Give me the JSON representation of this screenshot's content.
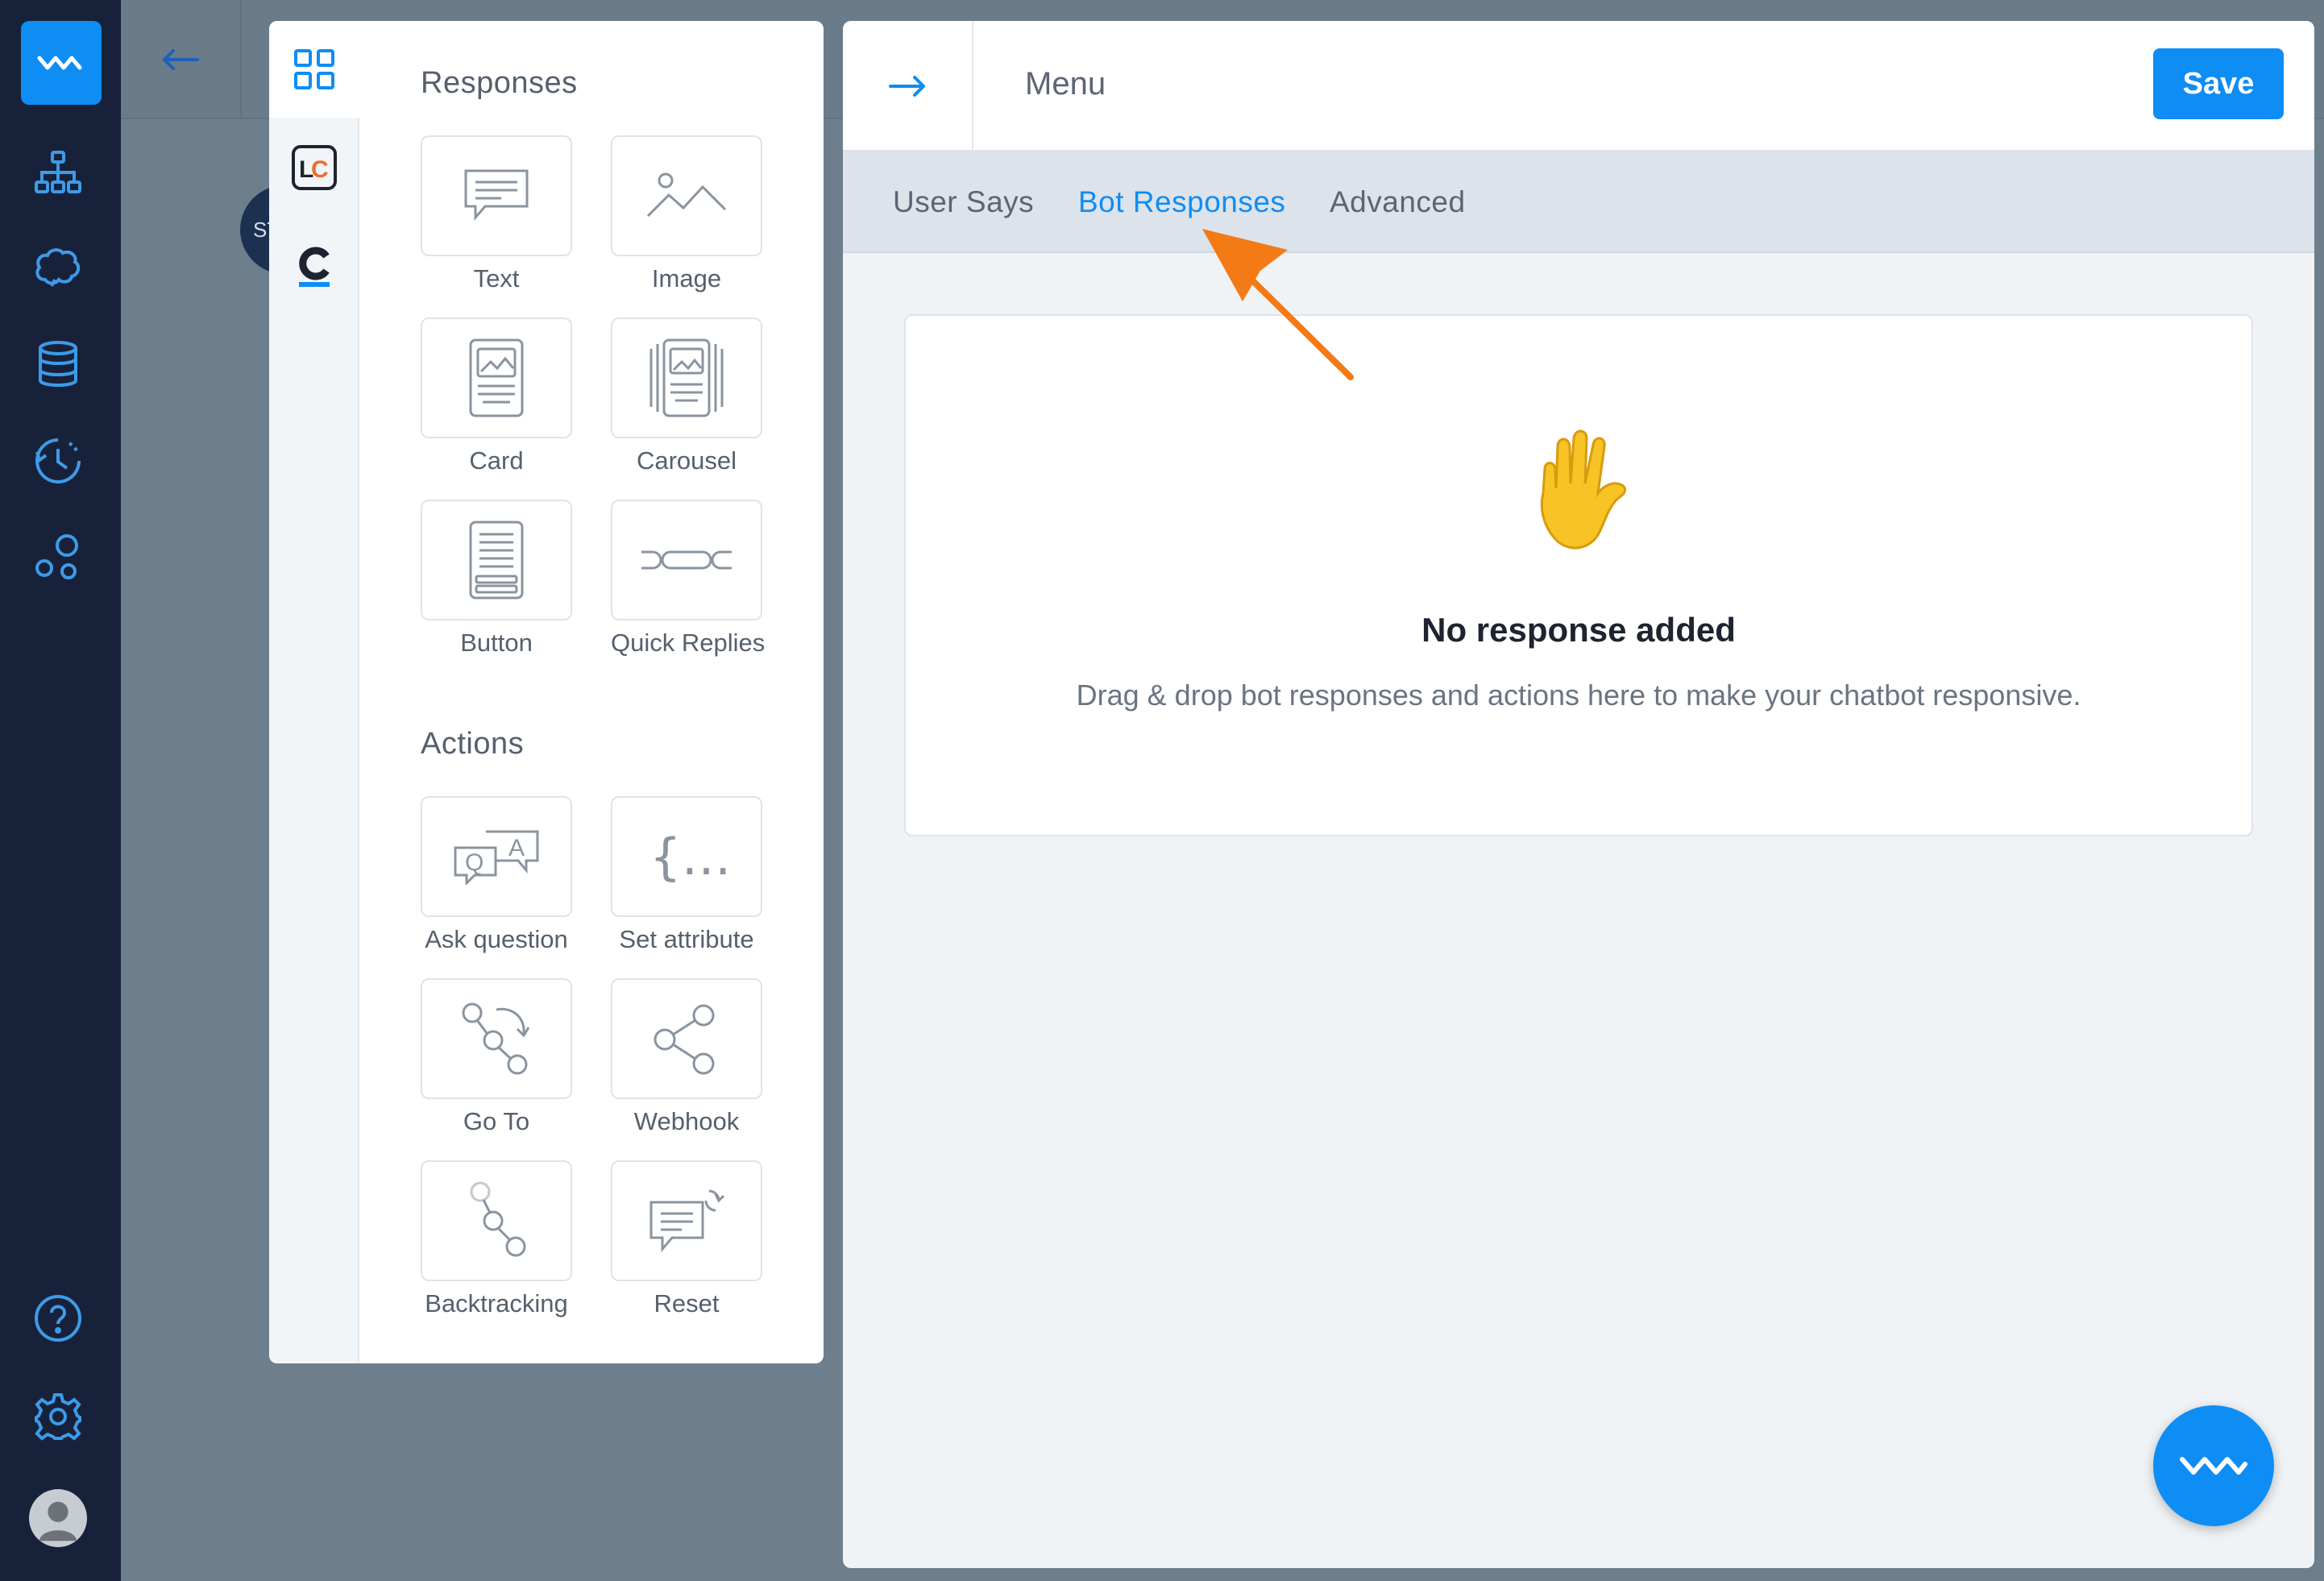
{
  "rail": {
    "brand_color": "#0e8df5",
    "icons": [
      "logo-wave-icon",
      "flow-tree-icon",
      "brain-icon",
      "database-icon",
      "history-clock-icon",
      "integrations-icon",
      "help-icon",
      "settings-gear-icon",
      "user-avatar"
    ]
  },
  "canvas": {
    "start_node_label": "ST"
  },
  "palette": {
    "tabs": [
      "grid-icon",
      "livechat-icon",
      "chatbot-c-icon"
    ],
    "responses_title": "Responses",
    "responses": [
      {
        "label": "Text",
        "icon": "text-bubble-icon"
      },
      {
        "label": "Image",
        "icon": "image-icon"
      },
      {
        "label": "Card",
        "icon": "card-icon"
      },
      {
        "label": "Carousel",
        "icon": "carousel-icon"
      },
      {
        "label": "Button",
        "icon": "button-icon"
      },
      {
        "label": "Quick Replies",
        "icon": "quick-replies-icon"
      }
    ],
    "actions_title": "Actions",
    "actions": [
      {
        "label": "Ask question",
        "icon": "qa-icon"
      },
      {
        "label": "Set attribute",
        "icon": "braces-icon"
      },
      {
        "label": "Go To",
        "icon": "goto-icon"
      },
      {
        "label": "Webhook",
        "icon": "share-nodes-icon"
      },
      {
        "label": "Backtracking",
        "icon": "backtracking-icon"
      },
      {
        "label": "Reset",
        "icon": "reset-icon"
      }
    ]
  },
  "editor": {
    "title": "Menu",
    "save_label": "Save",
    "tabs": [
      {
        "label": "User Says",
        "active": false
      },
      {
        "label": "Bot Responses",
        "active": true
      },
      {
        "label": "Advanced",
        "active": false
      }
    ],
    "empty_state": {
      "emoji": "✋",
      "title": "No response added",
      "description": "Drag & drop bot responses and actions here to make your chatbot responsive."
    }
  },
  "annotation": {
    "arrow_color": "#f47a16"
  }
}
